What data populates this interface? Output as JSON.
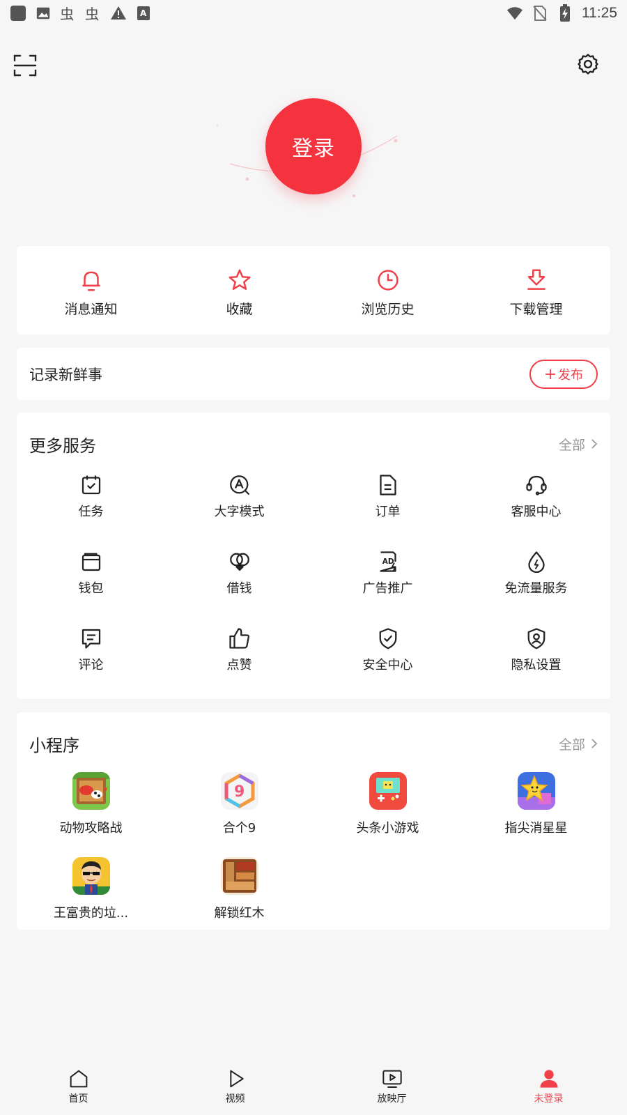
{
  "status_bar": {
    "time": "11:25",
    "left_icons": [
      "app-square-icon",
      "image-icon",
      "bug-icon",
      "bug-icon",
      "warning-icon",
      "font-icon"
    ],
    "right_icons": [
      "wifi-icon",
      "no-sim-icon",
      "battery-charging-icon"
    ]
  },
  "header": {
    "scan_icon": "scan-icon",
    "settings_icon": "gear-icon"
  },
  "login": {
    "label": "登录",
    "color": "#f4333f"
  },
  "quick_actions": [
    {
      "label": "消息通知",
      "icon": "bell-icon"
    },
    {
      "label": "收藏",
      "icon": "star-icon"
    },
    {
      "label": "浏览历史",
      "icon": "clock-icon"
    },
    {
      "label": "下载管理",
      "icon": "download-icon"
    }
  ],
  "post": {
    "title": "记录新鲜事",
    "button_label": "发布",
    "button_icon": "plus-icon"
  },
  "services": {
    "title": "更多服务",
    "all_label": "全部",
    "items": [
      {
        "label": "任务",
        "icon": "task-calendar-icon"
      },
      {
        "label": "大字模式",
        "icon": "large-font-icon"
      },
      {
        "label": "订单",
        "icon": "order-document-icon"
      },
      {
        "label": "客服中心",
        "icon": "headset-icon"
      },
      {
        "label": "钱包",
        "icon": "wallet-icon"
      },
      {
        "label": "借钱",
        "icon": "loan-icon"
      },
      {
        "label": "广告推广",
        "icon": "ad-icon"
      },
      {
        "label": "免流量服务",
        "icon": "data-drop-icon"
      },
      {
        "label": "评论",
        "icon": "comment-icon"
      },
      {
        "label": "点赞",
        "icon": "thumbs-up-icon"
      },
      {
        "label": "安全中心",
        "icon": "shield-check-icon"
      },
      {
        "label": "隐私设置",
        "icon": "privacy-user-icon"
      }
    ]
  },
  "mini_programs": {
    "title": "小程序",
    "all_label": "全部",
    "items": [
      {
        "label": "动物攻略战",
        "icon": "animal-game-icon"
      },
      {
        "label": "合个9",
        "icon": "hexagon-nine-icon"
      },
      {
        "label": "头条小游戏",
        "icon": "game-console-icon"
      },
      {
        "label": "指尖消星星",
        "icon": "star-game-icon"
      },
      {
        "label": "王富贵的垃...",
        "icon": "character-game-icon"
      },
      {
        "label": "解锁红木",
        "icon": "wood-block-icon"
      }
    ]
  },
  "bottom_nav": [
    {
      "label": "首页",
      "icon": "home-icon",
      "active": false
    },
    {
      "label": "视频",
      "icon": "play-icon",
      "active": false
    },
    {
      "label": "放映厅",
      "icon": "tv-play-icon",
      "active": false
    },
    {
      "label": "未登录",
      "icon": "user-icon",
      "active": true
    }
  ],
  "colors": {
    "accent": "#f0414b",
    "background": "#f6f6f7",
    "card": "#ffffff"
  }
}
